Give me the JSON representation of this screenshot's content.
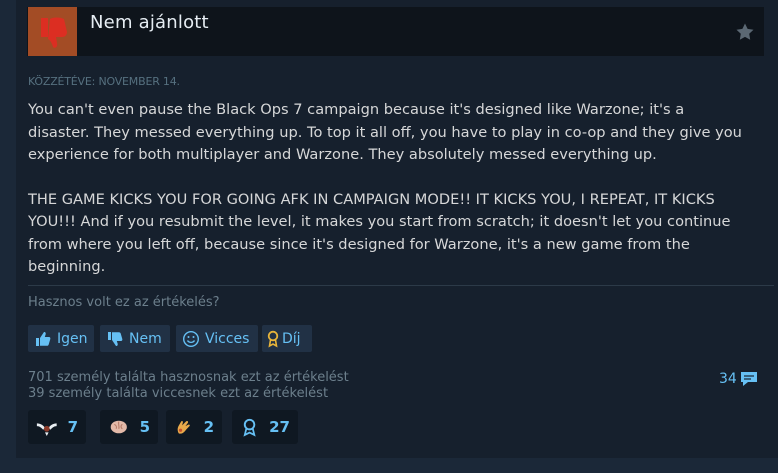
{
  "review": {
    "verdict": "Nem ajánlott",
    "posted": "KÖZZÉTÉVE: NOVEMBER 14.",
    "paragraphs": [
      "You can't even pause the Black Ops 7 campaign because it's designed like Warzone; it's a disaster. They messed everything up. To top it all off, you have to play in co-op and they give you experience for both multiplayer and Warzone. They absolutely messed everything up.",
      "THE GAME KICKS YOU FOR GOING AFK IN CAMPAIGN MODE!! IT KICKS YOU, I REPEAT, IT KICKS YOU!!! And if you resubmit the level, it makes you start from scratch; it doesn't let you continue from where you left off, because since it's designed for Warzone, it's a new game from the beginning."
    ]
  },
  "feedback": {
    "question": "Hasznos volt ez az értékelés?",
    "yes_label": "Igen",
    "no_label": "Nem",
    "funny_label": "Vicces",
    "award_label": "Díj"
  },
  "stats": {
    "helpful": "701 személy találta hasznosnak ezt az értékelést",
    "funny": "39 személy találta viccesnek ezt az értékelést",
    "comments": "34"
  },
  "awards": [
    {
      "icon": "winged-emblem-icon",
      "count": "7"
    },
    {
      "icon": "brain-icon",
      "count": "5"
    },
    {
      "icon": "hand-icon",
      "count": "2"
    },
    {
      "icon": "ribbon-medal-icon",
      "count": "27"
    }
  ],
  "colors": {
    "background": "#1b2838",
    "header": "#0e141b",
    "thumb_down": "#a34c25",
    "link_blue": "#66c0f4"
  }
}
